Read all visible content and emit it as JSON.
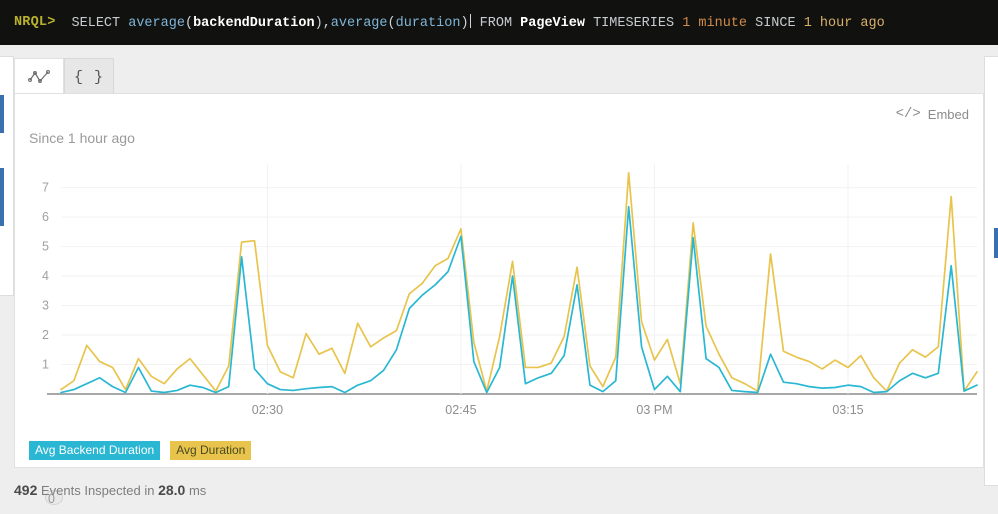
{
  "query_bar": {
    "prompt": "NRQL>",
    "segments": [
      {
        "t": "SELECT ",
        "c": "kw"
      },
      {
        "t": "average",
        "c": "fn"
      },
      {
        "t": "(",
        "c": "punct"
      },
      {
        "t": "backendDuration",
        "c": "id"
      },
      {
        "t": "),",
        "c": "punct"
      },
      {
        "t": "average",
        "c": "fn"
      },
      {
        "t": "(",
        "c": "punct"
      },
      {
        "t": "duration",
        "c": "fn"
      },
      {
        "t": ")",
        "c": "punct"
      },
      {
        "t": " FROM ",
        "c": "kw"
      },
      {
        "t": "PageView",
        "c": "id"
      },
      {
        "t": " TIMESERIES ",
        "c": "kw"
      },
      {
        "t": "1 minute",
        "c": "num"
      },
      {
        "t": " SINCE ",
        "c": "kw"
      },
      {
        "t": "1 hour ago",
        "c": "tm"
      }
    ],
    "full_text": "SELECT average(backendDuration),average(duration) FROM PageView TIMESERIES 1 minute SINCE 1 hour ago"
  },
  "tabs": [
    {
      "id": "chart",
      "icon": "line-chart-icon",
      "label": "",
      "active": true
    },
    {
      "id": "json",
      "icon": "braces-icon",
      "label": "{ }",
      "active": false
    }
  ],
  "card": {
    "embed_label": "Embed",
    "embed_icon": "code-brackets-icon",
    "since_label": "Since 1 hour ago"
  },
  "legend": [
    {
      "label": "Avg Backend Duration",
      "color": "#29b7d3"
    },
    {
      "label": "Avg Duration",
      "color": "#e8c44c"
    }
  ],
  "footer": {
    "events_count": "492",
    "events_text": "Events Inspected in",
    "duration_value": "28.0",
    "duration_unit": "ms"
  },
  "chart_data": {
    "type": "line",
    "title": "Since 1 hour ago",
    "xlabel": "",
    "ylabel": "",
    "grid": true,
    "legend_position": "bottom-left",
    "ylim": [
      0,
      7.8
    ],
    "yticks": [
      1,
      2,
      3,
      4,
      5,
      6,
      7
    ],
    "ytick_labels": [
      "1",
      "2",
      "3",
      "4",
      "5",
      "6",
      "7"
    ],
    "zero_label": "0",
    "xticks": [
      16,
      31,
      46,
      61
    ],
    "xtick_labels": [
      "02:30",
      "02:45",
      "03 PM",
      "03:15"
    ],
    "colors": {
      "Avg Backend Duration": "#29b7d3",
      "Avg Duration": "#e8c44c"
    },
    "series": [
      {
        "name": "Avg Backend Duration",
        "color": "#29b7d3",
        "values": [
          0.05,
          0.15,
          0.35,
          0.55,
          0.25,
          0.05,
          0.9,
          0.1,
          0.05,
          0.12,
          0.3,
          0.22,
          0.05,
          0.25,
          4.65,
          0.85,
          0.35,
          0.15,
          0.12,
          0.18,
          0.22,
          0.25,
          0.05,
          0.3,
          0.45,
          0.8,
          1.5,
          2.9,
          3.35,
          3.7,
          4.15,
          5.35,
          1.1,
          0.05,
          0.9,
          4.0,
          0.35,
          0.55,
          0.7,
          1.3,
          3.7,
          0.3,
          0.08,
          0.45,
          6.35,
          1.6,
          0.15,
          0.6,
          0.08,
          5.3,
          1.2,
          0.9,
          0.12,
          0.08,
          0.05,
          1.35,
          0.4,
          0.35,
          0.25,
          0.2,
          0.22,
          0.3,
          0.25,
          0.05,
          0.08,
          0.45,
          0.7,
          0.55,
          0.7,
          4.35,
          0.1,
          0.3
        ]
      },
      {
        "name": "Avg Duration",
        "color": "#e8c44c",
        "values": [
          0.15,
          0.45,
          1.65,
          1.1,
          0.9,
          0.15,
          1.2,
          0.6,
          0.35,
          0.85,
          1.2,
          0.65,
          0.1,
          0.95,
          5.15,
          5.2,
          1.65,
          0.75,
          0.55,
          2.05,
          1.35,
          1.55,
          0.7,
          2.4,
          1.6,
          1.9,
          2.15,
          3.4,
          3.75,
          4.35,
          4.6,
          5.6,
          1.75,
          0.1,
          1.95,
          4.5,
          0.9,
          0.9,
          1.05,
          1.95,
          4.3,
          0.95,
          0.25,
          1.25,
          7.5,
          2.45,
          1.15,
          1.85,
          0.35,
          5.8,
          2.3,
          1.35,
          0.55,
          0.35,
          0.1,
          4.75,
          1.45,
          1.25,
          1.1,
          0.85,
          1.15,
          0.9,
          1.3,
          0.55,
          0.1,
          1.05,
          1.5,
          1.25,
          1.6,
          6.7,
          0.1,
          0.75
        ]
      }
    ]
  }
}
